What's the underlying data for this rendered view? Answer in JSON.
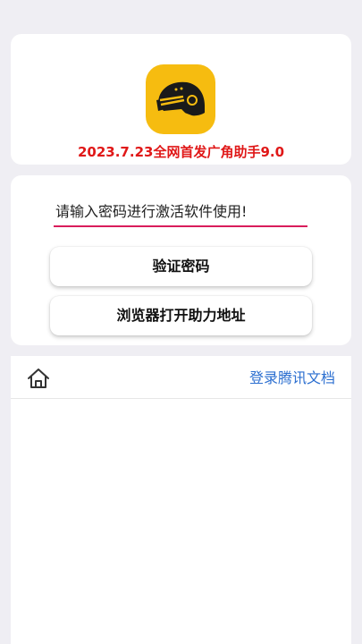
{
  "header": {
    "logo_icon": "helmet-icon",
    "headline": "2023.7.23全网首发广角助手9.0"
  },
  "activation": {
    "password_placeholder": "请输入密码进行激活软件使用!",
    "password_value": "",
    "verify_label": "验证密码",
    "open_browser_label": "浏览器打开助力地址"
  },
  "bottom_bar": {
    "home_icon": "home-icon",
    "link_label": "登录腾讯文档"
  },
  "colors": {
    "accent_input_underline": "#d91d5c",
    "headline_red": "#e01818",
    "logo_yellow": "#f6bc10",
    "link_blue": "#2c6fd0"
  }
}
